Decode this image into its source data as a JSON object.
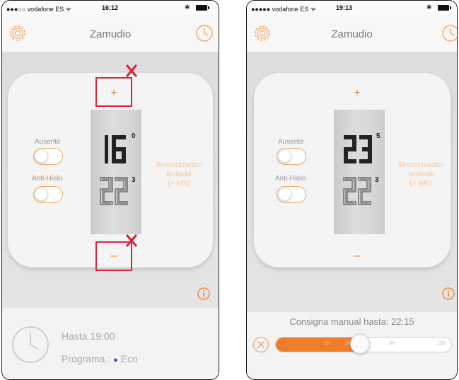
{
  "left": {
    "status": {
      "carrier": "●●●○○ vodafone ES ᯤ",
      "time": "16:12",
      "bt": "✱"
    },
    "header": {
      "title": "Zamudio"
    },
    "controls": {
      "plus": "+",
      "minus": "–"
    },
    "setpoint": {
      "value": "16",
      "decimal": "0"
    },
    "ambient": {
      "value": "22",
      "decimal": "3"
    },
    "modes": [
      {
        "label": "Ausente",
        "on": false
      },
      {
        "label": "Anti-Hielo",
        "on": false
      }
    ],
    "sync": {
      "line1": "Sincronización",
      "line2": "limitada",
      "line3": "(+ info)"
    },
    "footer": {
      "until": "Hasta 19:00",
      "program_prefix": "Programa : ",
      "program_dot": "●",
      "program_name": " Eco"
    },
    "annotation": {
      "x": "X"
    }
  },
  "right": {
    "status": {
      "carrier": "●●●●● vodafone ES ᯤ",
      "time": "19:13",
      "bt": "✱"
    },
    "header": {
      "title": "Zamudio"
    },
    "controls": {
      "plus": "+",
      "minus": "–"
    },
    "setpoint": {
      "value": "23",
      "decimal": "5"
    },
    "ambient": {
      "value": "22",
      "decimal": "3"
    },
    "modes": [
      {
        "label": "Ausente",
        "on": false
      },
      {
        "label": "Anti-Hielo",
        "on": false
      }
    ],
    "sync": {
      "line1": "Sincronización",
      "line2": "limitada",
      "line3": "(+ info)"
    },
    "footer": {
      "manual": "Consigna manual hasta: 22:15"
    },
    "slider": {
      "ticks": [
        "1h",
        "2h",
        "6h",
        "12h"
      ],
      "position": "3h"
    }
  },
  "colors": {
    "accent": "#f07d2a",
    "annotation": "#d9263a",
    "program": "#2b4fc7",
    "digits": "#222222"
  },
  "icons": [
    "gear-icon",
    "clock-icon",
    "info-icon",
    "cancel-icon",
    "annotation-x-icon"
  ]
}
